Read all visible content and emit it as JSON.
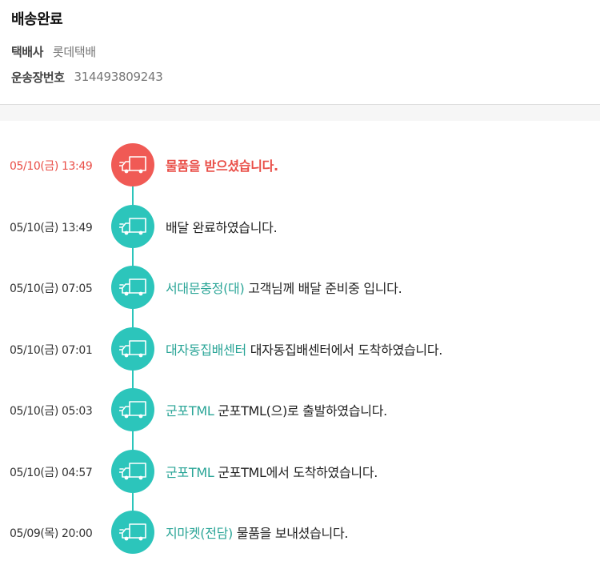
{
  "header": {
    "title": "배송완료",
    "courier_label": "택배사",
    "courier_value": "롯데택배",
    "tracking_label": "운송장번호",
    "tracking_value": "314493809243"
  },
  "colors": {
    "accent": "#2cc5bb",
    "current": "#f05a55",
    "location_text": "#2aa597"
  },
  "events": [
    {
      "time": "05/10(금) 13:49",
      "location": "",
      "message": "물품을 받으셨습니다.",
      "icon": "truck-icon",
      "current": true
    },
    {
      "time": "05/10(금) 13:49",
      "location": "",
      "message": "배달 완료하였습니다.",
      "icon": "truck-icon"
    },
    {
      "time": "05/10(금) 07:05",
      "location": "서대문충정(대)",
      "message": "고객님께 배달 준비중 입니다.",
      "icon": "truck-icon"
    },
    {
      "time": "05/10(금) 07:01",
      "location": "대자동집배센터",
      "message": "대자동집배센터에서 도착하였습니다.",
      "icon": "truck-icon"
    },
    {
      "time": "05/10(금) 05:03",
      "location": "군포TML",
      "message": "군포TML(으)로 출발하였습니다.",
      "icon": "truck-icon"
    },
    {
      "time": "05/10(금) 04:57",
      "location": "군포TML",
      "message": "군포TML에서 도착하였습니다.",
      "icon": "truck-icon"
    },
    {
      "time": "05/09(목) 20:00",
      "location": "지마켓(전담)",
      "message": "물품을 보내셨습니다.",
      "icon": "truck-icon"
    }
  ]
}
